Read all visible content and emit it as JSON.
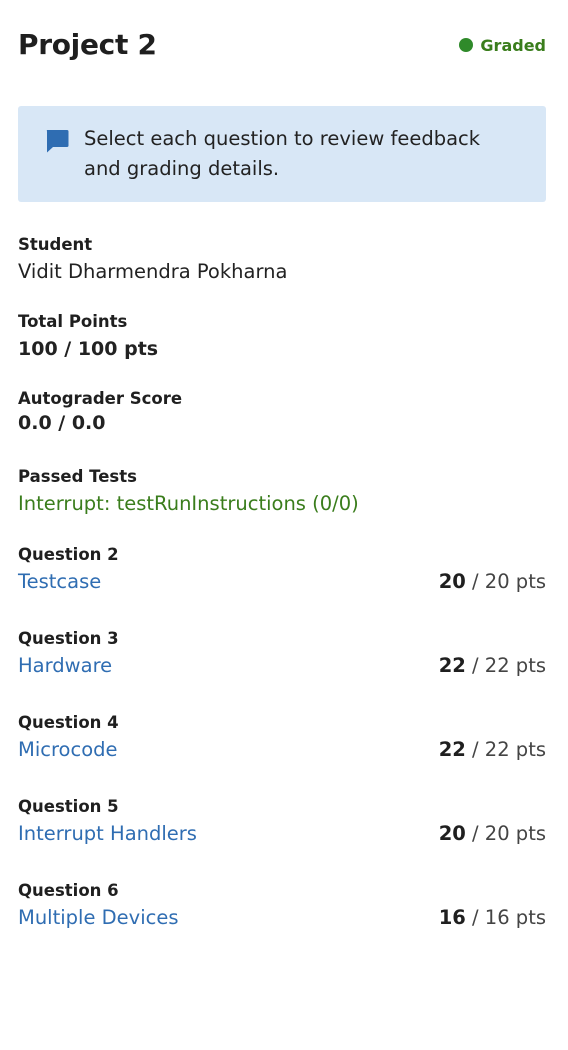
{
  "header": {
    "title": "Project 2",
    "status": "Graded",
    "status_color": "#2f8a2a"
  },
  "notice": {
    "icon": "comment-icon",
    "text": "Select each question to review feedback and grading details."
  },
  "student": {
    "label": "Student",
    "value": "Vidit Dharmendra Pokharna"
  },
  "total_points": {
    "label": "Total Points",
    "value": "100 / 100 pts"
  },
  "autograder": {
    "label": "Autograder Score",
    "value": "0.0 / 0.0"
  },
  "passed_tests": {
    "label": "Passed Tests",
    "items": [
      "Interrupt: testRunInstructions (0/0)"
    ]
  },
  "questions": [
    {
      "label": "Question 2",
      "name": "Testcase",
      "earned": "20",
      "total": "/ 20 pts"
    },
    {
      "label": "Question 3",
      "name": "Hardware",
      "earned": "22",
      "total": "/ 22 pts"
    },
    {
      "label": "Question 4",
      "name": "Microcode",
      "earned": "22",
      "total": "/ 22 pts"
    },
    {
      "label": "Question 5",
      "name": "Interrupt Handlers",
      "earned": "20",
      "total": "/ 20 pts"
    },
    {
      "label": "Question 6",
      "name": "Multiple Devices",
      "earned": "16",
      "total": "/ 16 pts"
    }
  ],
  "colors": {
    "accent_link": "#2f6db2",
    "passed_text": "#3a7d1c",
    "notice_bg": "#d8e7f6",
    "notice_icon": "#2f6db2"
  }
}
